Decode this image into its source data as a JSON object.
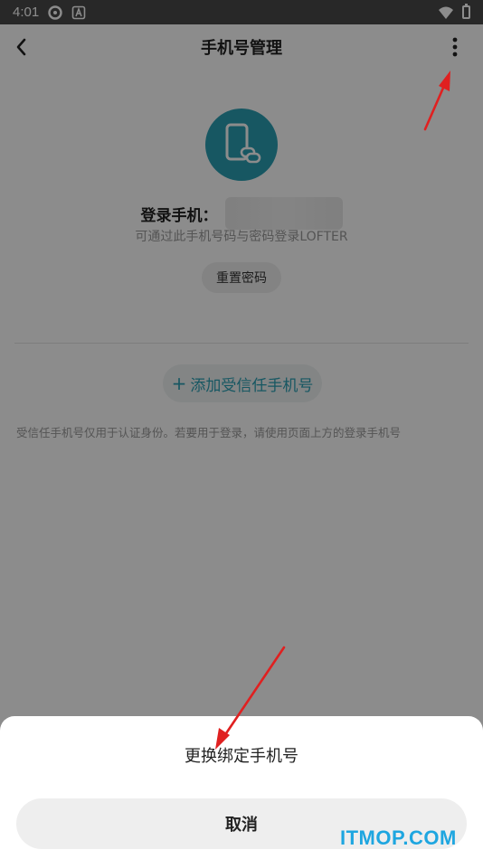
{
  "status_bar": {
    "time": "4:01"
  },
  "header": {
    "title": "手机号管理"
  },
  "login": {
    "label": "登录手机：",
    "hint": "可通过此手机号码与密码登录LOFTER",
    "reset_password_label": "重置密码"
  },
  "trusted": {
    "add_label": "添加受信任手机号",
    "note": "受信任手机号仅用于认证身份。若要用于登录，请使用页面上方的登录手机号"
  },
  "sheet": {
    "option_label": "更换绑定手机号",
    "cancel_label": "取消"
  },
  "watermark": {
    "text": "ITMOP.COM"
  },
  "colors": {
    "accent": "#2a9fb3",
    "annotation": "#e02020",
    "watermark": "#1ea6e0"
  }
}
